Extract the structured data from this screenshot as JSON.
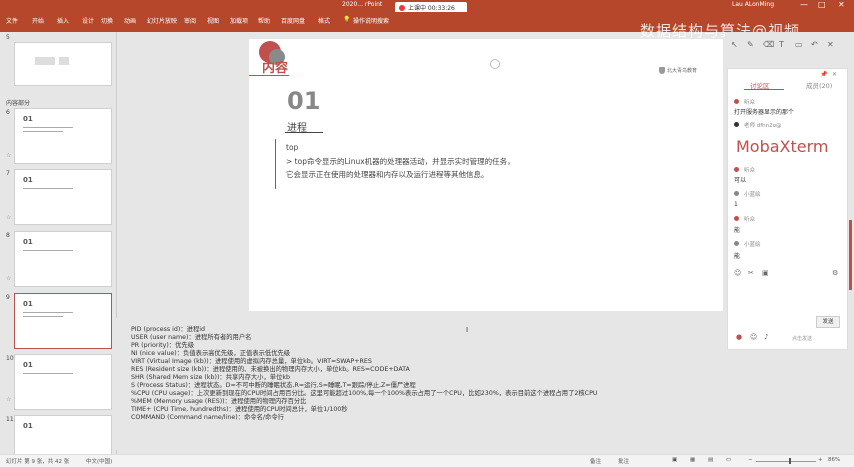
{
  "titlebar": {
    "doc_title": "2020...  rPoint",
    "recording": "上课中 00:33:26",
    "user": "Lau ALonMing",
    "min": "—",
    "max": "□",
    "close": "✕"
  },
  "ribbon_tabs": [
    "文件",
    "开始",
    "插入",
    "设计",
    "切换",
    "动画",
    "幻灯片放映",
    "审阅",
    "视图",
    "加载项",
    "帮助",
    "百度网盘",
    "格式",
    "操作说明搜索"
  ],
  "watermark": "数据结构与算法@视频",
  "thumbnails": {
    "section1": "5",
    "section_label": "内容部分",
    "items": [
      {
        "num": "6",
        "label": "01"
      },
      {
        "num": "7",
        "label": "01"
      },
      {
        "num": "8",
        "label": "01"
      },
      {
        "num": "9",
        "label": "01"
      },
      {
        "num": "10",
        "label": "01"
      },
      {
        "num": "11",
        "label": "01"
      }
    ]
  },
  "slide": {
    "title": "内容",
    "number": "01",
    "subtitle": "进程",
    "lines": [
      "top",
      "> top命令显示的Linux机器的处理器活动，并显示实时管理的任务，",
      "它会显示正在使用的处理器和内存以及运行进程等其他信息。"
    ],
    "logo": "北大青鸟教育"
  },
  "notes": [
    "PID (process id)：进程id",
    "USER (user name)：进程所有者的用户名",
    "PR (priority)：优先级",
    "NI (nice value)：负值表示高优先级，正值表示低优先级",
    "VIRT (Virtual Image (kb))：进程使用的虚拟内存总量，单位kb。VIRT=SWAP+RES",
    "RES (Resident size (kb))：进程使用的、未被换出的物理内存大小，单位kb。RES=CODE+DATA",
    "SHR (Shared Mem size (kb))：共享内存大小，单位kb",
    "S (Process Status)：进程状态。D=不可中断的睡眠状态,R=运行,S=睡眠,T=跟踪/停止,Z=僵尸进程",
    "%CPU (CPU usage)：上次更新到现在的CPU时间占用百分比。这里可能超过100%,每一个100%表示占用了一个CPU，比如230%，表示目前这个进程占用了2核CPU",
    "%MEM (Memory usage (RES))：进程使用的物理内存百分比",
    "TIME+ (CPU Time, hundredths)：进程使用的CPU时间总计，单位1/100秒",
    "COMMAND (Command name/line)：命令名/命令行"
  ],
  "comments": {
    "tab_discussion": "讨论区",
    "tab_members": "成员(20)",
    "items": [
      {
        "name": "听众",
        "msg": "打开服务器显示的那个"
      },
      {
        "name": "老师 dfhn2o@",
        "msg": ""
      },
      {
        "name": "听众",
        "msg": "可以"
      },
      {
        "name": "小蓝绘",
        "msg": "1"
      },
      {
        "name": "听众",
        "msg": "能"
      },
      {
        "name": "小蓝绘",
        "msg": "能"
      }
    ],
    "big_text": "MobaXterm",
    "send": "发送",
    "hint": "点击发送"
  },
  "statusbar": {
    "slide_info": "幻灯片 第 9 张，共 42 张",
    "lang": "中文(中国)",
    "notes": "备注",
    "comments": "批注",
    "zoom": "86%"
  }
}
